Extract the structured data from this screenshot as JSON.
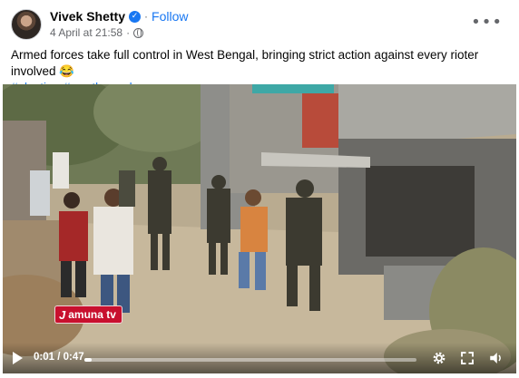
{
  "post": {
    "author": "Vivek Shetty",
    "separator": "·",
    "follow_label": "Follow",
    "timestamp": "4 April at 21:58",
    "meta_separator": "·",
    "more_label": "•••",
    "text": "Armed forces take full control in West Bengal, bringing strict action against every rioter involved 😂",
    "hashtags": [
      "#election",
      "#westbengal"
    ]
  },
  "video": {
    "watermark_letter": "J",
    "watermark_text": "amuna tv",
    "current_time": "0:01 / 0:47",
    "progress_fraction": 0.021,
    "icons": [
      "play-icon",
      "settings-gear-icon",
      "fullscreen-icon",
      "volume-icon"
    ]
  },
  "colors": {
    "accent": "#1877f2",
    "secondary_text": "#65676b",
    "watermark_red": "#c8102e"
  }
}
